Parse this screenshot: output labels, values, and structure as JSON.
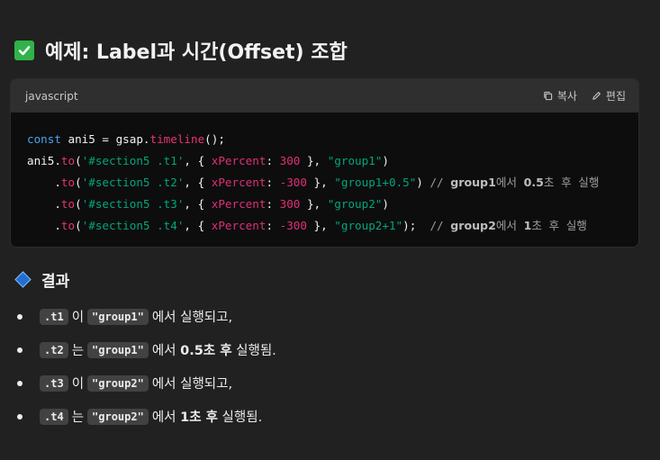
{
  "heading": {
    "icon": "check-mark-button-icon",
    "text": "예제: Label과 시간(Offset) 조합"
  },
  "code_block": {
    "language": "javascript",
    "copy_label": "복사",
    "edit_label": "편집",
    "lines": [
      [
        [
          "kw",
          "const"
        ],
        [
          "plain",
          " ani5 = gsap."
        ],
        [
          "fn",
          "timeline"
        ],
        [
          "plain",
          "();"
        ]
      ],
      [
        [
          "plain",
          "ani5."
        ],
        [
          "fn",
          "to"
        ],
        [
          "plain",
          "("
        ],
        [
          "str",
          "'#section5 .t1'"
        ],
        [
          "plain",
          ", { "
        ],
        [
          "prop",
          "xPercent"
        ],
        [
          "plain",
          ": "
        ],
        [
          "num",
          "300"
        ],
        [
          "plain",
          " }, "
        ],
        [
          "str",
          "\"group1\""
        ],
        [
          "plain",
          ")"
        ]
      ],
      [
        [
          "plain",
          "    ."
        ],
        [
          "fn",
          "to"
        ],
        [
          "plain",
          "("
        ],
        [
          "str",
          "'#section5 .t2'"
        ],
        [
          "plain",
          ", { "
        ],
        [
          "prop",
          "xPercent"
        ],
        [
          "plain",
          ": "
        ],
        [
          "num",
          "-300"
        ],
        [
          "plain",
          " }, "
        ],
        [
          "str",
          "\"group1+0.5\""
        ],
        [
          "plain",
          ") "
        ],
        [
          "cm",
          "// "
        ],
        [
          "cm-strong",
          "group1"
        ],
        [
          "cm",
          "에서 "
        ],
        [
          "cm-strong",
          "0.5"
        ],
        [
          "cm",
          "초 후 실행"
        ]
      ],
      [
        [
          "plain",
          "    ."
        ],
        [
          "fn",
          "to"
        ],
        [
          "plain",
          "("
        ],
        [
          "str",
          "'#section5 .t3'"
        ],
        [
          "plain",
          ", { "
        ],
        [
          "prop",
          "xPercent"
        ],
        [
          "plain",
          ": "
        ],
        [
          "num",
          "300"
        ],
        [
          "plain",
          " }, "
        ],
        [
          "str",
          "\"group2\""
        ],
        [
          "plain",
          ")"
        ]
      ],
      [
        [
          "plain",
          "    ."
        ],
        [
          "fn",
          "to"
        ],
        [
          "plain",
          "("
        ],
        [
          "str",
          "'#section5 .t4'"
        ],
        [
          "plain",
          ", { "
        ],
        [
          "prop",
          "xPercent"
        ],
        [
          "plain",
          ": "
        ],
        [
          "num",
          "-300"
        ],
        [
          "plain",
          " }, "
        ],
        [
          "str",
          "\"group2+1\""
        ],
        [
          "plain",
          ");  "
        ],
        [
          "cm",
          "// "
        ],
        [
          "cm-strong",
          "group2"
        ],
        [
          "cm",
          "에서 "
        ],
        [
          "cm-strong",
          "1"
        ],
        [
          "cm",
          "초 후 실행"
        ]
      ]
    ]
  },
  "result": {
    "icon": "blue-diamond-icon",
    "title": "결과",
    "items": [
      {
        "target": ".t1",
        "particle": "이",
        "group": "\"group1\"",
        "pre": "에서 ",
        "bold": "",
        "post": "실행되고,"
      },
      {
        "target": ".t2",
        "particle": "는",
        "group": "\"group1\"",
        "pre": "에서 ",
        "bold": "0.5초 후",
        "post": " 실행됨."
      },
      {
        "target": ".t3",
        "particle": "이",
        "group": "\"group2\"",
        "pre": "에서 ",
        "bold": "",
        "post": "실행되고,"
      },
      {
        "target": ".t4",
        "particle": "는",
        "group": "\"group2\"",
        "pre": "에서 ",
        "bold": "1초 후",
        "post": " 실행됨."
      }
    ]
  },
  "colors": {
    "background": "#212121",
    "code_background": "#0d0d0d",
    "code_header": "#2f2f2f",
    "keyword": "#4aa3ee",
    "function": "#e8356e",
    "string": "#00a67d",
    "number": "#df3079",
    "comment": "#9d9d9d",
    "check": "#2fb34a",
    "diamond": "#1f6fd1"
  }
}
